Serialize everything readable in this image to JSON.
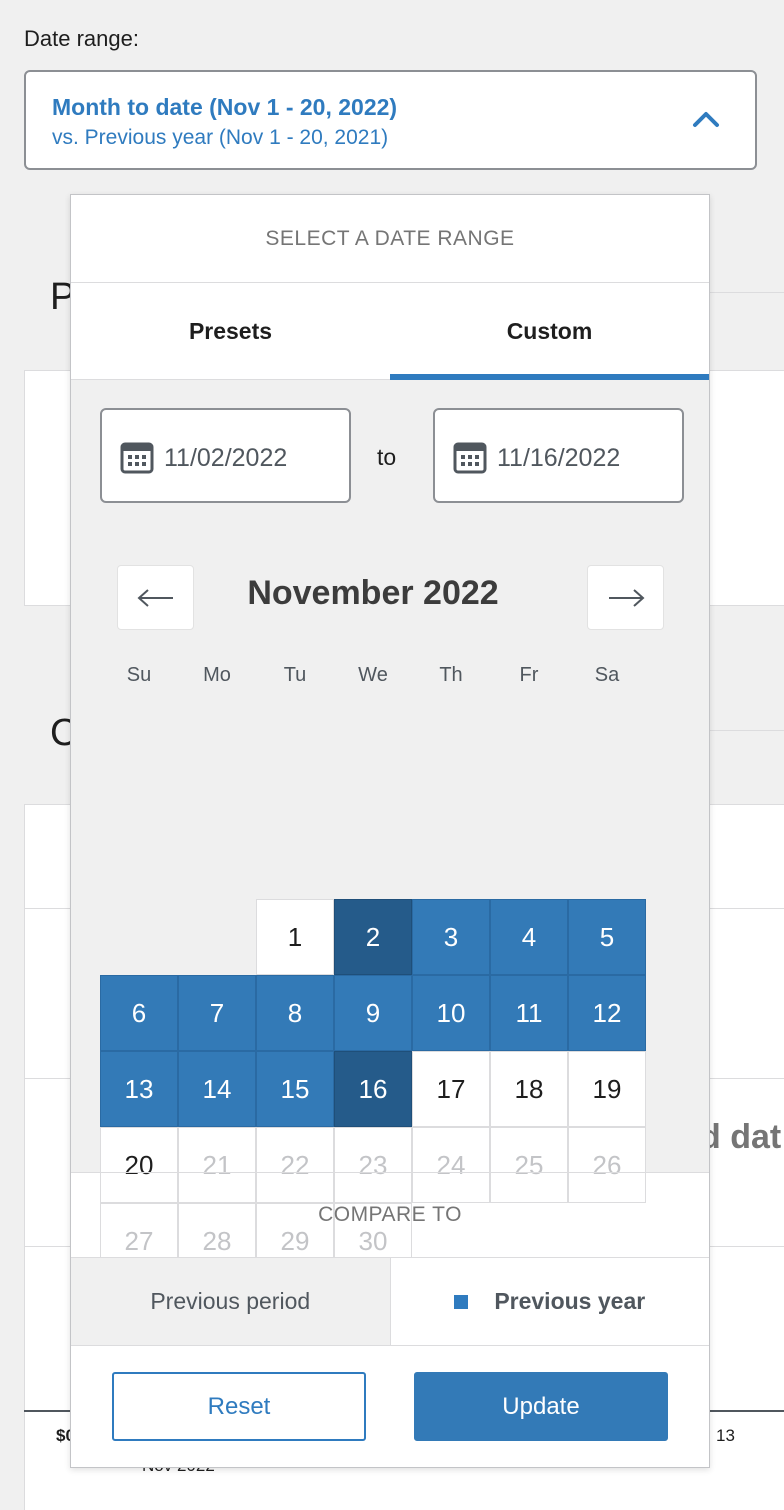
{
  "date_range_label": "Date range:",
  "toggle": {
    "primary": "Month to date (Nov 1 - 20, 2022)",
    "secondary": "vs. Previous year (Nov 1 - 20, 2021)",
    "icon": "chevron-up-icon"
  },
  "background": {
    "heading_1": "P",
    "heading_2": "C",
    "partial_text": "d dat",
    "axis_left": "$0",
    "axis_bottom": "Nov 2022",
    "axis_right": "13"
  },
  "popover": {
    "title": "SELECT A DATE RANGE",
    "tabs": [
      {
        "label": "Presets"
      },
      {
        "label": "Custom"
      }
    ],
    "start_date": "11/02/2022",
    "to_label": "to",
    "end_date": "11/16/2022",
    "month_label": "November 2022",
    "prev_icon": "arrow-left-icon",
    "next_icon": "arrow-right-icon",
    "weekdays": [
      "Su",
      "Mo",
      "Tu",
      "We",
      "Th",
      "Fr",
      "Sa"
    ],
    "days": [
      "1",
      "2",
      "3",
      "4",
      "5",
      "6",
      "7",
      "8",
      "9",
      "10",
      "11",
      "12",
      "13",
      "14",
      "15",
      "16",
      "17",
      "18",
      "19",
      "20",
      "21",
      "22",
      "23",
      "24",
      "25",
      "26",
      "27",
      "28",
      "29",
      "30"
    ],
    "compare_title": "COMPARE TO",
    "compare_options": [
      {
        "label": "Previous period"
      },
      {
        "label": "Previous year"
      }
    ],
    "reset_label": "Reset",
    "update_label": "Update"
  },
  "colors": {
    "accent": "#2f7bbf",
    "selected_day": "#337ab7",
    "range_edge_day": "#255b8a"
  }
}
